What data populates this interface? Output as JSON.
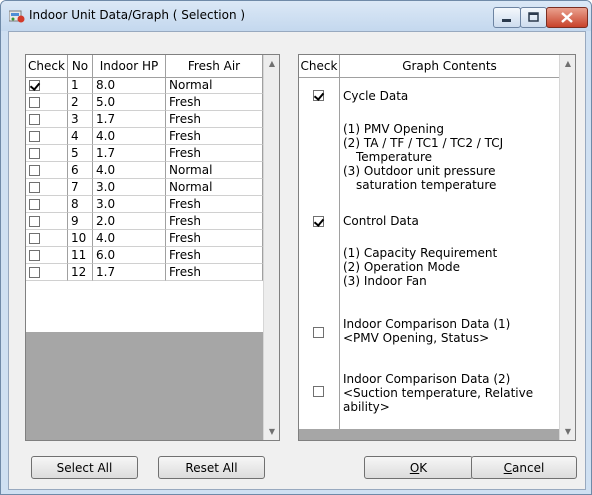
{
  "window": {
    "title": "Indoor Unit Data/Graph ( Selection )"
  },
  "left_table": {
    "headers": [
      "Check",
      "No",
      "Indoor HP",
      "Fresh Air"
    ],
    "rows": [
      {
        "checked": true,
        "no": "1",
        "hp": "8.0",
        "air": "Normal"
      },
      {
        "checked": false,
        "no": "2",
        "hp": "5.0",
        "air": "Fresh"
      },
      {
        "checked": false,
        "no": "3",
        "hp": "1.7",
        "air": "Fresh"
      },
      {
        "checked": false,
        "no": "4",
        "hp": "4.0",
        "air": "Fresh"
      },
      {
        "checked": false,
        "no": "5",
        "hp": "1.7",
        "air": "Fresh"
      },
      {
        "checked": false,
        "no": "6",
        "hp": "4.0",
        "air": "Normal"
      },
      {
        "checked": false,
        "no": "7",
        "hp": "3.0",
        "air": "Normal"
      },
      {
        "checked": false,
        "no": "8",
        "hp": "3.0",
        "air": "Fresh"
      },
      {
        "checked": false,
        "no": "9",
        "hp": "2.0",
        "air": "Fresh"
      },
      {
        "checked": false,
        "no": "10",
        "hp": "4.0",
        "air": "Fresh"
      },
      {
        "checked": false,
        "no": "11",
        "hp": "6.0",
        "air": "Fresh"
      },
      {
        "checked": false,
        "no": "12",
        "hp": "1.7",
        "air": "Fresh"
      }
    ]
  },
  "right_table": {
    "headers": [
      "Check",
      "Graph Contents"
    ],
    "cycle": {
      "checked": true,
      "title": "Cycle Data",
      "l1": "(1) PMV Opening",
      "l2": "(2) TA / TF / TC1 / TC2 / TCJ",
      "l2b": "Temperature",
      "l3": "(3) Outdoor unit pressure",
      "l3b": "saturation temperature"
    },
    "control": {
      "checked": true,
      "title": "Control Data",
      "l1": "(1) Capacity Requirement",
      "l2": "(2) Operation Mode",
      "l3": "(3) Indoor Fan"
    },
    "comp1": {
      "checked": false,
      "title": "Indoor Comparison Data (1)",
      "l1": "<PMV Opening, Status>"
    },
    "comp2": {
      "checked": false,
      "title": "Indoor Comparison Data (2)",
      "l1": "<Suction temperature, Relative",
      "l2": "ability>"
    }
  },
  "buttons": {
    "select_all": "Select All",
    "reset_all": "Reset All",
    "ok_u": "O",
    "ok_rest": "K",
    "cancel_u": "C",
    "cancel_rest": "ancel"
  }
}
